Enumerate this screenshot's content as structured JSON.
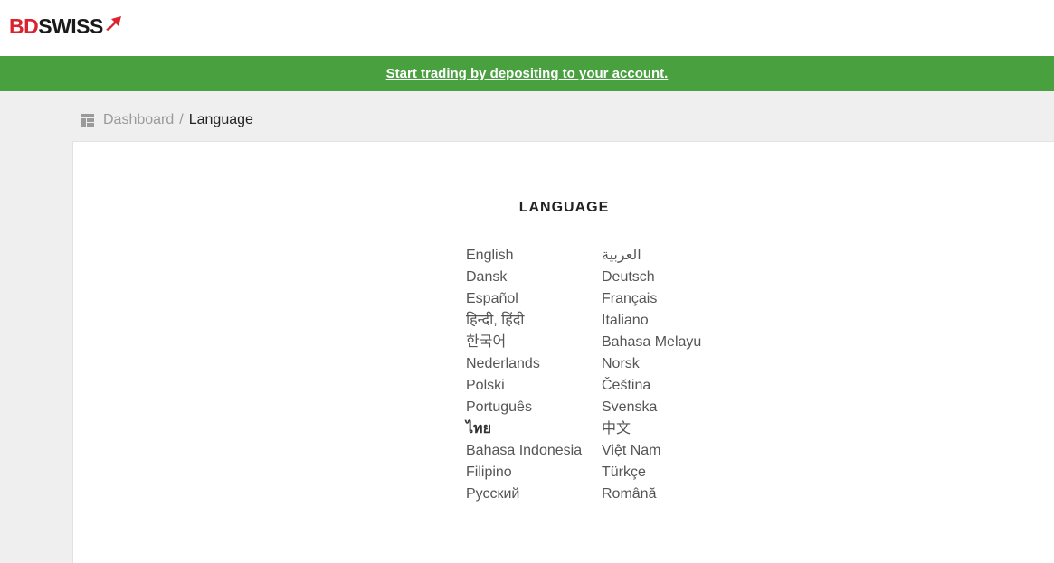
{
  "brand": {
    "part1": "BD",
    "part2": "SWISS"
  },
  "banner": {
    "text": "Start trading by depositing to your account."
  },
  "breadcrumb": {
    "dashboard": "Dashboard",
    "separator": "/",
    "current": "Language"
  },
  "page": {
    "title": "LANGUAGE"
  },
  "languages": [
    "English",
    "العربية",
    "Dansk",
    "Deutsch",
    "Español",
    "Français",
    "हिन्दी, हिंदी",
    "Italiano",
    "한국어",
    "Bahasa Melayu",
    "Nederlands",
    "Norsk",
    "Polski",
    "Čeština",
    "Português",
    "Svenska",
    "ไทย",
    "中文",
    "Bahasa Indonesia",
    "Việt Nam",
    "Filipino",
    "Türkçe",
    "Русский",
    "Română"
  ],
  "colors": {
    "brand_red": "#d9232e",
    "banner_green": "#48a03e"
  }
}
